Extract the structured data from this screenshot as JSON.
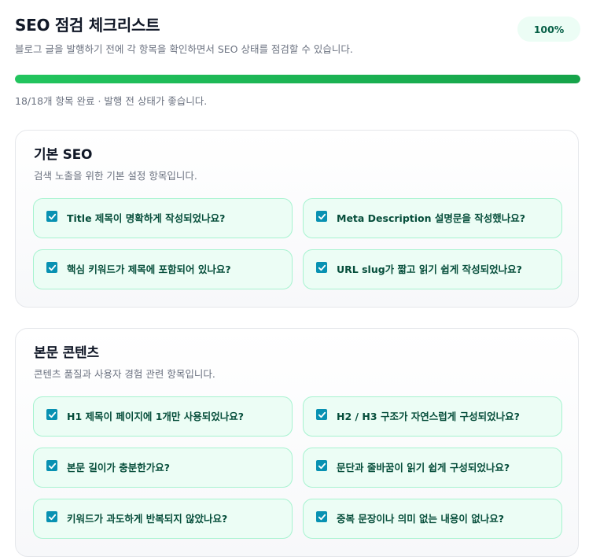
{
  "header": {
    "title": "SEO 점검 체크리스트",
    "subtitle": "블로그 글을 발행하기 전에 각 항목을 확인하면서 SEO 상태를 점검할 수 있습니다.",
    "badge": "100%"
  },
  "progress": {
    "value": 100,
    "text": "18/18개 항목 완료 · 발행 전 상태가 좋습니다."
  },
  "sections": [
    {
      "title": "기본 SEO",
      "desc": "검색 노출을 위한 기본 설정 항목입니다.",
      "items": [
        {
          "label": "Title 제목이 명확하게 작성되었나요?",
          "checked": true
        },
        {
          "label": "Meta Description 설명문을 작성했나요?",
          "checked": true
        },
        {
          "label": "핵심 키워드가 제목에 포함되어 있나요?",
          "checked": true
        },
        {
          "label": "URL slug가 짧고 읽기 쉽게 작성되었나요?",
          "checked": true
        }
      ]
    },
    {
      "title": "본문 콘텐츠",
      "desc": "콘텐츠 품질과 사용자 경험 관련 항목입니다.",
      "items": [
        {
          "label": "H1 제목이 페이지에 1개만 사용되었나요?",
          "checked": true
        },
        {
          "label": "H2 / H3 구조가 자연스럽게 구성되었나요?",
          "checked": true
        },
        {
          "label": "본문 길이가 충분한가요?",
          "checked": true
        },
        {
          "label": "문단과 줄바꿈이 읽기 쉽게 구성되었나요?",
          "checked": true
        },
        {
          "label": "키워드가 과도하게 반복되지 않았나요?",
          "checked": true
        },
        {
          "label": "중복 문장이나 의미 없는 내용이 없나요?",
          "checked": true
        }
      ]
    }
  ],
  "colors": {
    "accent": "#22c55e",
    "checkbox": "#0891b2",
    "item_bg": "#ecfdf5",
    "item_border": "#a7f3d0"
  }
}
